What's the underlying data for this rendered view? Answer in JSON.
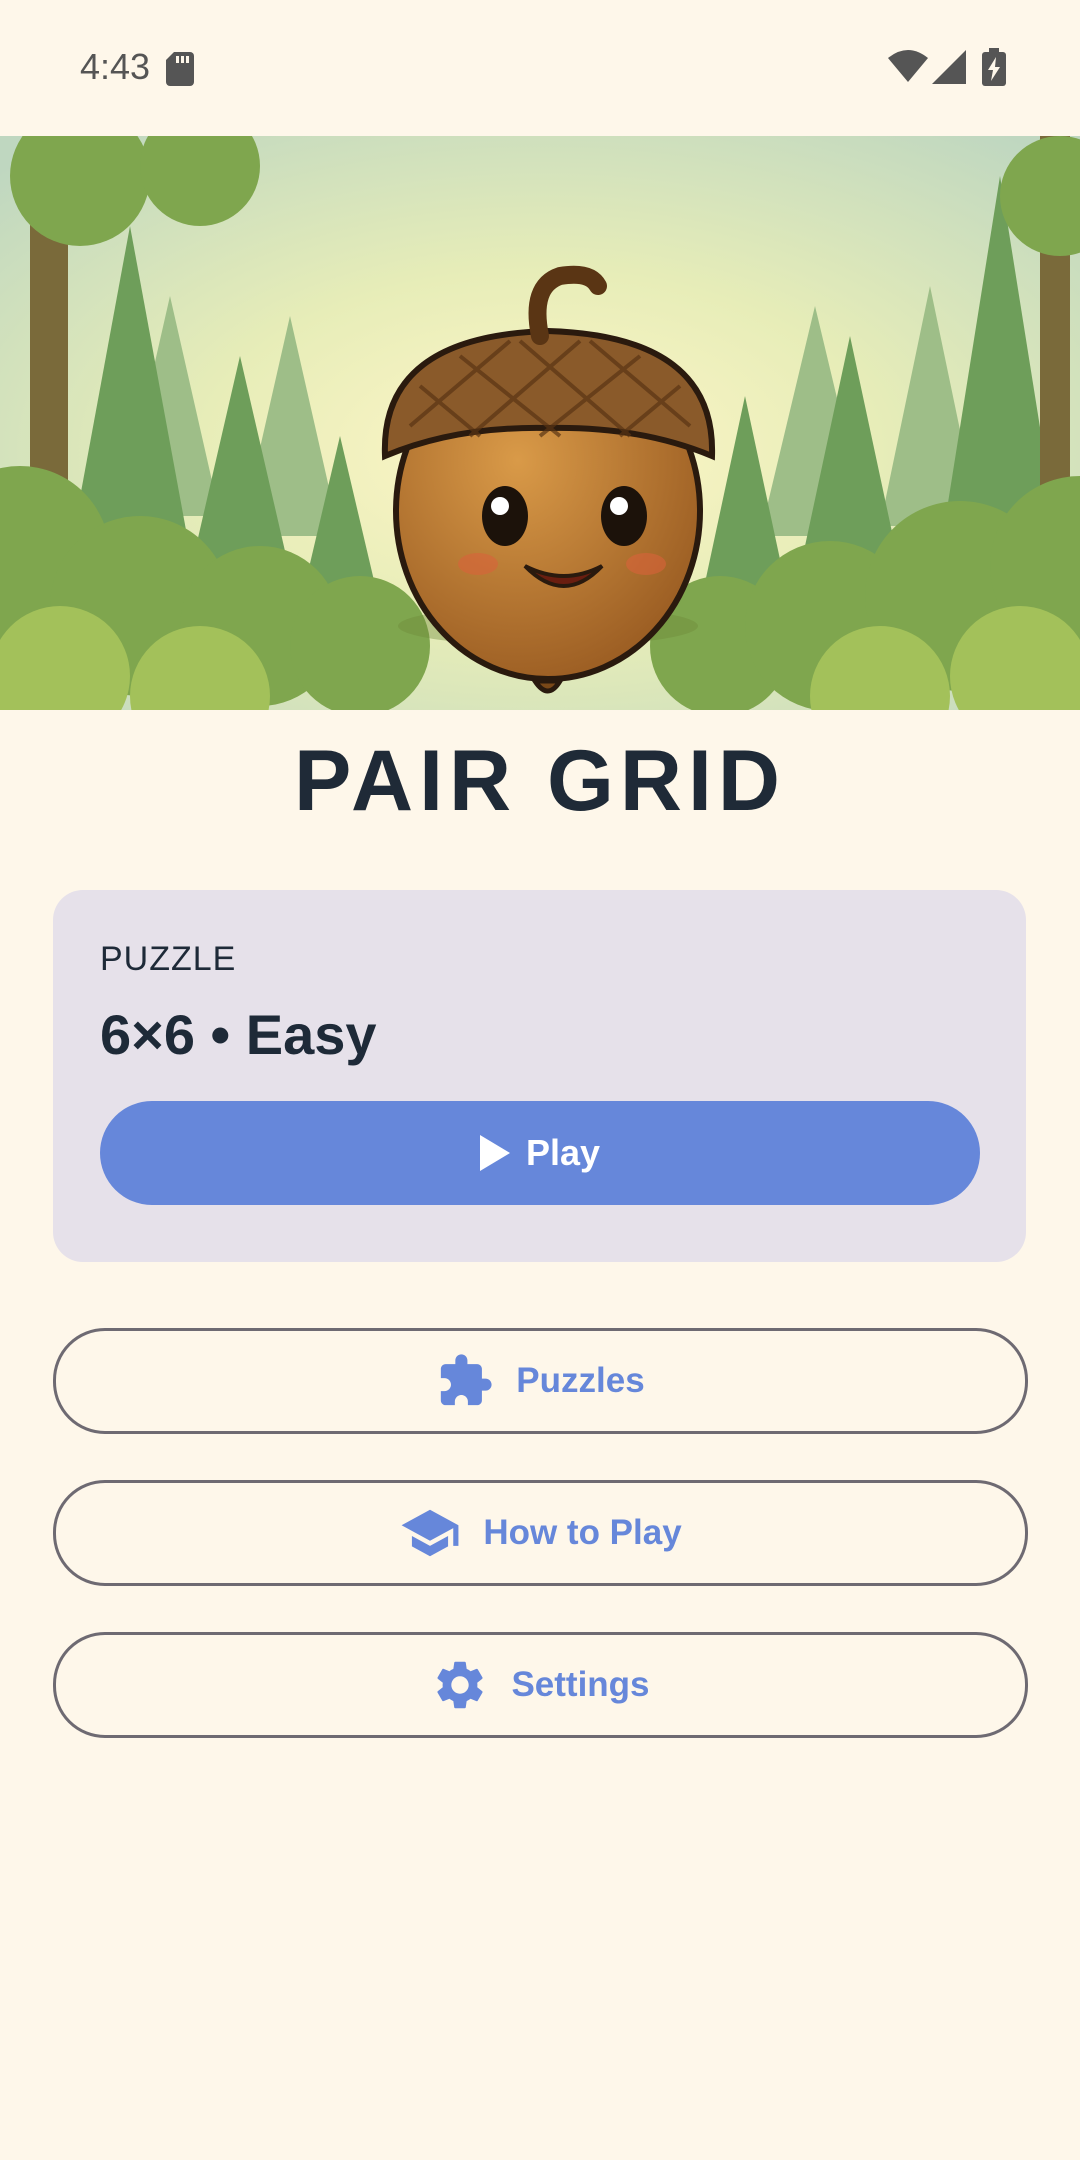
{
  "status_bar": {
    "time": "4:43"
  },
  "title": "PAIR GRID",
  "puzzle_card": {
    "label": "PUZZLE",
    "value": "6×6 • Easy",
    "play_label": "Play"
  },
  "menu": {
    "puzzles_label": "Puzzles",
    "how_to_play_label": "How to Play",
    "settings_label": "Settings"
  },
  "icons": {
    "status": [
      "sd-card-icon",
      "wifi-icon",
      "signal-icon",
      "battery-charging-icon"
    ],
    "play": "play-icon",
    "puzzles": "puzzle-piece-icon",
    "how_to_play": "graduation-cap-icon",
    "settings": "gear-icon"
  },
  "colors": {
    "background": "#FEF7EA",
    "accent": "#6687DA",
    "card": "#E6E1EA",
    "title": "#1F2A37"
  }
}
